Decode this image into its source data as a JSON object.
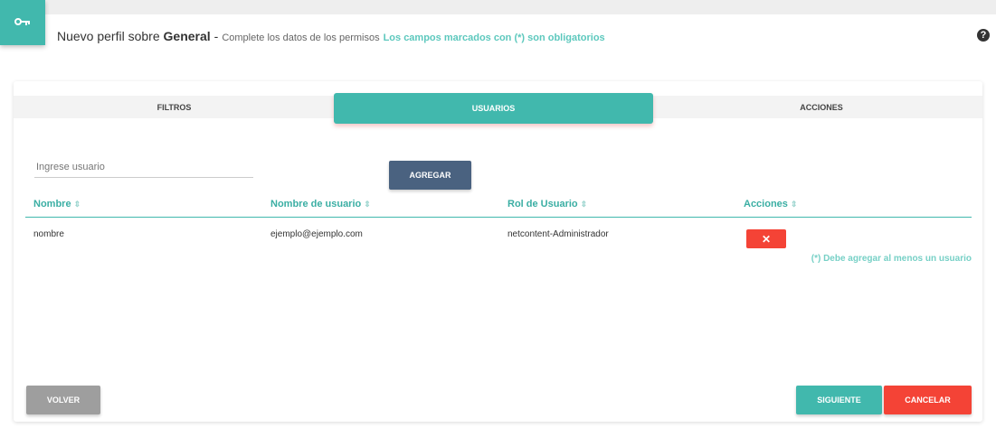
{
  "header": {
    "prefix": "Nuevo perfil sobre",
    "entity": "General",
    "separator": "-",
    "description": "Complete los datos de los permisos",
    "required_note": "Los campos marcados con (*) son obligatorios"
  },
  "icons": {
    "header": "key-icon",
    "help": "question-circle-icon",
    "sort": "sort-icon",
    "delete": "close-icon"
  },
  "colors": {
    "accent": "#41b8ad",
    "danger": "#f44336",
    "primary_dark": "#4a6280",
    "neutral": "#9e9e9e"
  },
  "tabs": [
    {
      "label": "FILTROS",
      "active": false
    },
    {
      "label": "USUARIOS",
      "active": true
    },
    {
      "label": "ACCIONES",
      "active": false
    }
  ],
  "user_input": {
    "placeholder": "Ingrese usuario",
    "value": ""
  },
  "add_button": "AGREGAR",
  "table": {
    "columns": [
      "Nombre",
      "Nombre de usuario",
      "Rol de Usuario",
      "Acciones"
    ],
    "sort_glyph": "⇕",
    "rows": [
      {
        "nombre": "nombre",
        "usuario": "ejemplo@ejemplo.com",
        "rol": "netcontent-Administrador",
        "delete": "✕"
      }
    ]
  },
  "warning": "(*) Debe agregar al menos un usuario",
  "footer": {
    "back": "VOLVER",
    "next": "SIGUIENTE",
    "cancel": "CANCELAR"
  }
}
